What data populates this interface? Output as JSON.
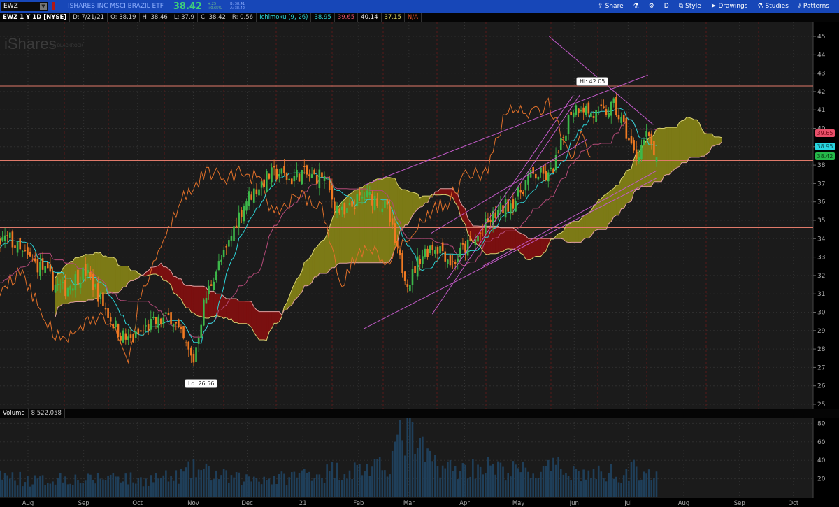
{
  "header": {
    "symbol": "EWZ",
    "description": "ISHARES INC MSCI BRAZIL ETF",
    "last": "38.42",
    "change": "+.25",
    "change_pct": "+0.65%",
    "bid": "B: 38.41",
    "ask": "A: 38.42",
    "tools": [
      {
        "label": "Share",
        "icon": "share-icon"
      },
      {
        "label": "",
        "icon": "flask-icon"
      },
      {
        "label": "",
        "icon": "gear-icon"
      },
      {
        "label": "D",
        "icon": ""
      },
      {
        "label": "Style",
        "icon": "style-icon"
      },
      {
        "label": "Drawings",
        "icon": "cursor-icon"
      },
      {
        "label": "Studies",
        "icon": "flask-icon"
      },
      {
        "label": "Patterns",
        "icon": "patterns-icon"
      }
    ]
  },
  "info": {
    "title": "EWZ 1 Y 1D [NYSE]",
    "date": "D: 7/21/21",
    "open": "O: 38.19",
    "high": "H: 38.46",
    "low": "L: 37.9",
    "close": "C: 38.42",
    "range": "R: 0.56",
    "study": "Ichimoku (9, 26)",
    "tenkan": "38.95",
    "kijun": "39.65",
    "span_a": "40.14",
    "span_b": "37.15",
    "chikou": "N/A"
  },
  "watermark": {
    "brand": "iShares",
    "by": "by BLACKROCK"
  },
  "volume": {
    "label": "Volume",
    "value": "8,522,058"
  },
  "colors": {
    "up": "#3db84a",
    "down": "#f07a22",
    "tenkan": "#2cd3d6",
    "kijun": "#b34a78",
    "chikou": "#e0702a",
    "cloud_bull": "#7c7a16",
    "cloud_bear": "#7a1010",
    "hline": "#e07a6a",
    "trend": "#c25ac8",
    "tag_kijun": "#e8506a",
    "tag_tenkan": "#28d6e0",
    "tag_last": "#25b84a"
  },
  "chart_data": {
    "type": "candlestick",
    "title": "EWZ 1 Y 1D [NYSE]",
    "day_zero": "2020-08-01",
    "keypoints_start_date": "2020-04-29",
    "keypoint_step_days": 6,
    "close_keypoints": [
      26,
      26.8,
      27.5,
      26.8,
      27.4,
      28.2,
      28,
      29,
      29.6,
      30.5,
      31.5,
      33,
      33.6,
      33.8,
      34,
      33.2,
      32.8,
      32.4,
      31.6,
      31.2,
      31.8,
      32.2,
      31.2,
      30,
      29,
      28.4,
      28.8,
      29.3,
      29.5,
      29.8,
      28.5,
      27.3,
      30.5,
      32.2,
      33.2,
      35,
      36.2,
      36.8,
      37.4,
      37.6,
      37.2,
      37.6,
      37.3,
      37.5,
      36,
      35.2,
      36,
      36.3,
      36.2,
      35.5,
      33,
      31.6,
      33,
      33.6,
      33.5,
      32.6,
      33.4,
      33.8,
      34.6,
      35.3,
      35.8,
      36.2,
      37.3,
      37.5,
      37.3,
      38.8,
      41,
      41.3,
      40.7,
      40.8,
      41.2,
      40,
      38.4,
      39.6,
      38.42
    ],
    "volume_keypoints_millions": [
      30,
      30,
      30,
      30,
      30,
      30,
      30,
      30,
      30,
      30,
      30,
      30,
      30,
      25,
      22,
      20,
      18,
      18,
      20,
      22,
      20,
      18,
      20,
      22,
      25,
      20,
      18,
      20,
      22,
      20,
      25,
      30,
      28,
      25,
      22,
      20,
      20,
      22,
      20,
      20,
      22,
      25,
      28,
      25,
      30,
      28,
      30,
      32,
      30,
      35,
      60,
      70,
      50,
      40,
      35,
      30,
      30,
      32,
      35,
      30,
      28,
      30,
      28,
      25,
      30,
      32,
      30,
      25,
      25,
      25,
      28,
      25,
      30,
      30,
      20
    ],
    "price_axis": {
      "min": 25,
      "max": 45,
      "ticks": [
        "25",
        "26",
        "27",
        "28",
        "29",
        "30",
        "31",
        "32",
        "33",
        "34",
        "35",
        "36",
        "37",
        "38",
        "39",
        "40",
        "41",
        "42",
        "43",
        "44",
        "45"
      ]
    },
    "volume_axis": {
      "min": 0,
      "max": 80,
      "ticks": [
        "20",
        "40",
        "60",
        "80"
      ]
    },
    "months": [
      {
        "label": "Aug",
        "date": "2020-08-01"
      },
      {
        "label": "Sep",
        "date": "2020-09-01"
      },
      {
        "label": "Oct",
        "date": "2020-10-01"
      },
      {
        "label": "Nov",
        "date": "2020-11-01"
      },
      {
        "label": "Dec",
        "date": "2020-12-01"
      },
      {
        "label": "21",
        "date": "2021-01-01"
      },
      {
        "label": "Feb",
        "date": "2021-02-01"
      },
      {
        "label": "Mar",
        "date": "2021-03-01"
      },
      {
        "label": "Apr",
        "date": "2021-04-01"
      },
      {
        "label": "May",
        "date": "2021-05-01"
      },
      {
        "label": "Jun",
        "date": "2021-06-01"
      },
      {
        "label": "Jul",
        "date": "2021-07-01"
      },
      {
        "label": "Aug",
        "date": "2021-08-01"
      },
      {
        "label": "Sep",
        "date": "2021-09-01"
      },
      {
        "label": "Oct",
        "date": "2021-10-01"
      }
    ],
    "horizontal_lines": [
      42.3,
      38.25,
      34.6
    ],
    "trend_lines": [
      {
        "d1": 186.8,
        "p1": 36.9,
        "d2": 345,
        "p2": 42.9
      },
      {
        "d1": 186.8,
        "p1": 29.1,
        "d2": 350,
        "p2": 37.3
      },
      {
        "d1": 225,
        "p1": 29.9,
        "d2": 307,
        "p2": 41.8
      },
      {
        "d1": 224.5,
        "p1": 34.3,
        "d2": 311,
        "p2": 39.4
      },
      {
        "d1": 233.5,
        "p1": 31.8,
        "d2": 303.5,
        "p2": 41.8
      },
      {
        "d1": 253,
        "p1": 32.5,
        "d2": 350,
        "p2": 37.7
      },
      {
        "d1": 290,
        "p1": 45.0,
        "d2": 348,
        "p2": 40.2
      }
    ],
    "annotations": {
      "hi": "Hi: 42.05",
      "lo": "Lo: 26.56"
    },
    "price_tags": {
      "kijun": "39.65",
      "tenkan": "38.95",
      "last": "38.42"
    }
  }
}
